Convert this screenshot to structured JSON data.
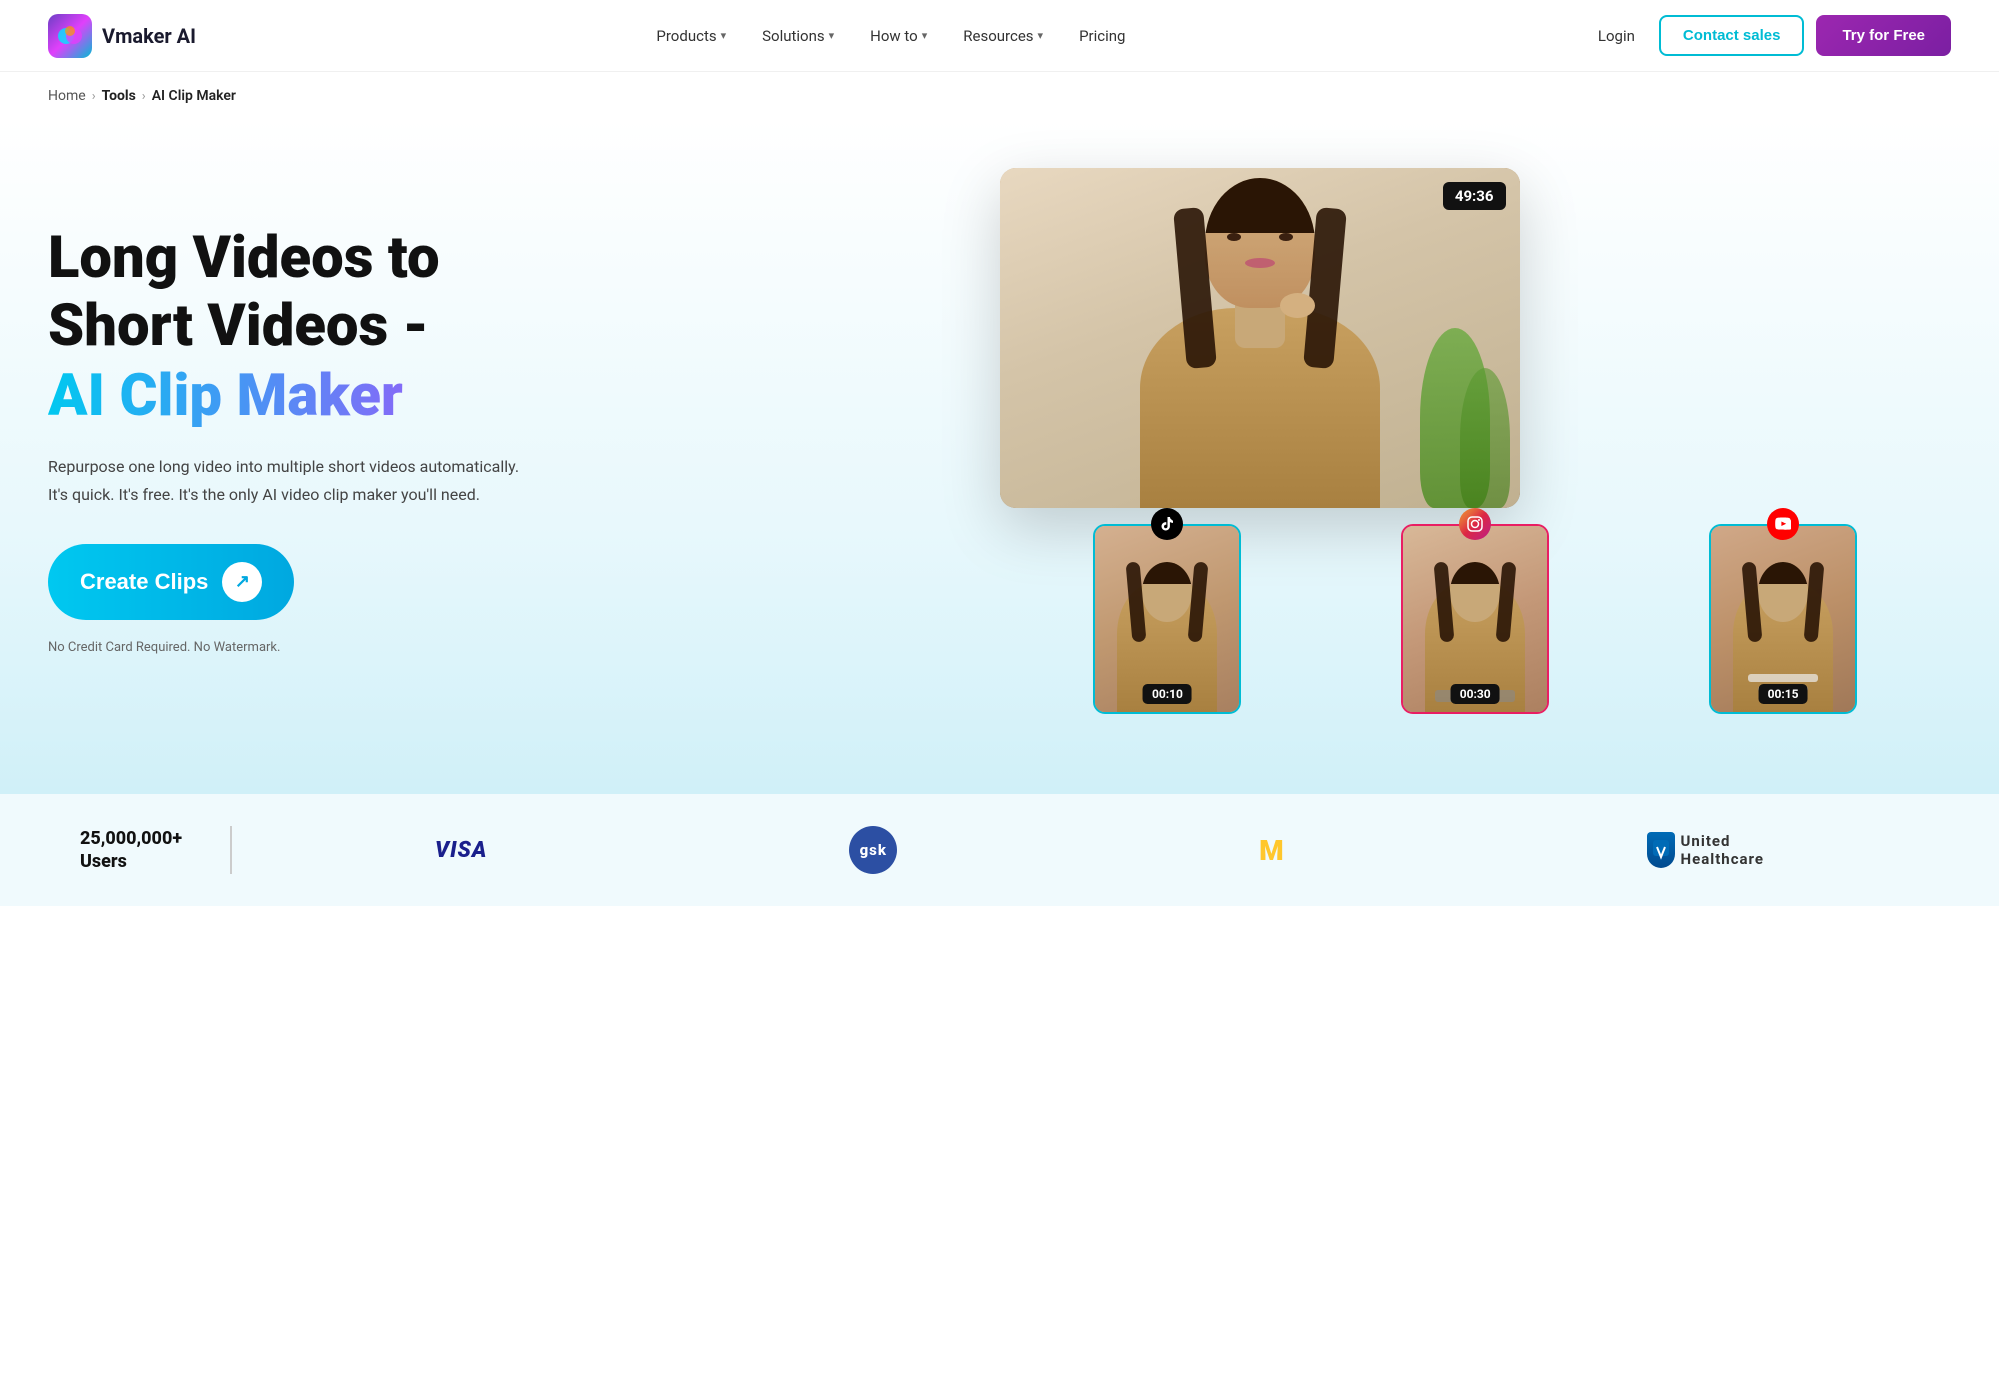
{
  "brand": {
    "name": "Vmaker AI",
    "logo_emoji": "🎬"
  },
  "navbar": {
    "products_label": "Products",
    "solutions_label": "Solutions",
    "howto_label": "How to",
    "resources_label": "Resources",
    "pricing_label": "Pricing",
    "login_label": "Login",
    "contact_label": "Contact sales",
    "try_label": "Try for Free"
  },
  "breadcrumb": {
    "home": "Home",
    "tools": "Tools",
    "current": "AI Clip Maker"
  },
  "hero": {
    "title_line1": "Long Videos to",
    "title_line2": "Short Videos -",
    "title_gradient": "AI Clip Maker",
    "description": "Repurpose one long video into multiple short videos automatically. It's quick. It's free. It's the only AI video clip maker you'll need.",
    "cta_button": "Create Clips",
    "cta_note": "No Credit Card Required. No Watermark.",
    "video_timer": "49:36"
  },
  "clips": [
    {
      "social": "TT",
      "social_label": "tiktok",
      "timestamp": "00:10"
    },
    {
      "social": "IG",
      "social_label": "instagram",
      "timestamp": "00:30"
    },
    {
      "social": "YT",
      "social_label": "youtube",
      "timestamp": "00:15"
    }
  ],
  "bottom": {
    "users_count": "25,000,000+",
    "users_label": "Users",
    "brands": [
      {
        "name": "VISA",
        "type": "visa"
      },
      {
        "name": "gsk",
        "type": "gsk"
      },
      {
        "name": "M",
        "type": "mcdonalds"
      },
      {
        "name": "United Healthcare",
        "type": "uhc"
      }
    ]
  }
}
